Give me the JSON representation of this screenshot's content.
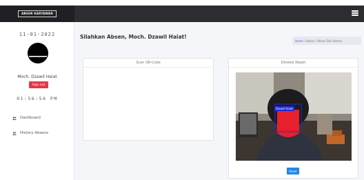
{
  "header": {
    "brand": "ABSEN KARYAWAN",
    "colors": {
      "topbar": "#2b2d31",
      "brand_bg": "#1f2023"
    }
  },
  "sidebar": {
    "date": "11-01-2022",
    "username": "Moch. Dzawil Haiat",
    "signout_label": "Sign out",
    "clock": "01:56:56 PM",
    "items": [
      {
        "label": "Dashboard",
        "icon": "users-icon"
      },
      {
        "label": "History Absens",
        "icon": "users-icon"
      }
    ]
  },
  "main": {
    "title": "Silahkan Absen, Moch. Dzawil Haiat!",
    "breadcrumb": {
      "home": "Home",
      "current": "Absen / Absen Dari Kantor"
    },
    "qr_card": {
      "header": "Scan QR-Code"
    },
    "face_card": {
      "header": "Deteksi Wajah",
      "face_label": "Dzawil Haiat",
      "reset_label": "Reset"
    }
  },
  "colors": {
    "accent": "#1e88e5",
    "danger": "#e03a48",
    "face_box": "#e8202e"
  }
}
